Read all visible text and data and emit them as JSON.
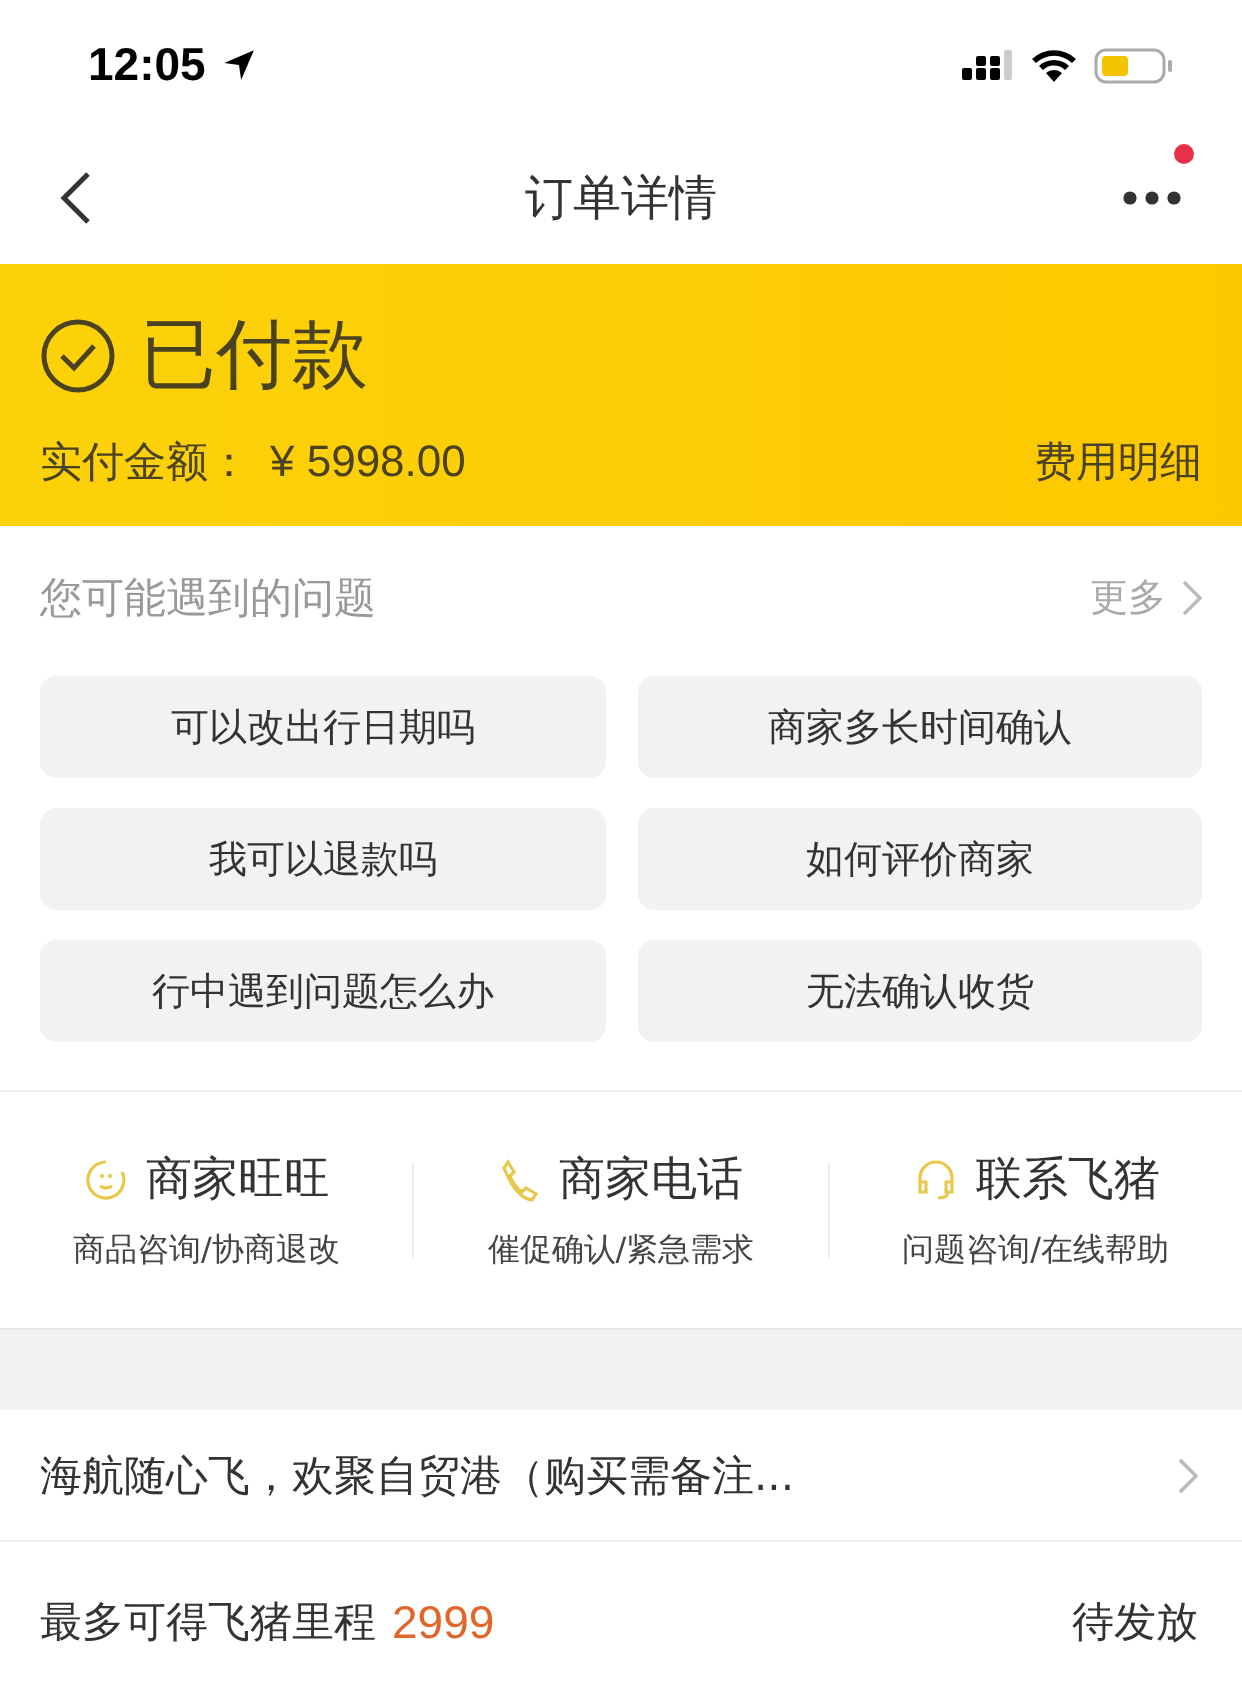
{
  "status_bar": {
    "time": "12:05"
  },
  "nav": {
    "title": "订单详情",
    "has_notification": true
  },
  "order_status": {
    "status": "已付款",
    "amount_label": "实付金额：",
    "amount": "¥ 5998.00",
    "detail_link": "费用明细"
  },
  "faq": {
    "title": "您可能遇到的问题",
    "more": "更多",
    "questions": [
      "可以改出行日期吗",
      "商家多长时间确认",
      "我可以退款吗",
      "如何评价商家",
      "行中遇到问题怎么办",
      "无法确认收货"
    ]
  },
  "contacts": [
    {
      "kind": "chat",
      "title": "商家旺旺",
      "subtitle": "商品咨询/协商退改"
    },
    {
      "kind": "phone",
      "title": "商家电话",
      "subtitle": "催促确认/紧急需求"
    },
    {
      "kind": "headset",
      "title": "联系飞猪",
      "subtitle": "问题咨询/在线帮助"
    }
  ],
  "promo": {
    "text": "海航随心飞，欢聚自贸港（购买需备注..."
  },
  "mileage": {
    "label": "最多可得飞猪里程",
    "value": "2999",
    "status": "待发放"
  }
}
